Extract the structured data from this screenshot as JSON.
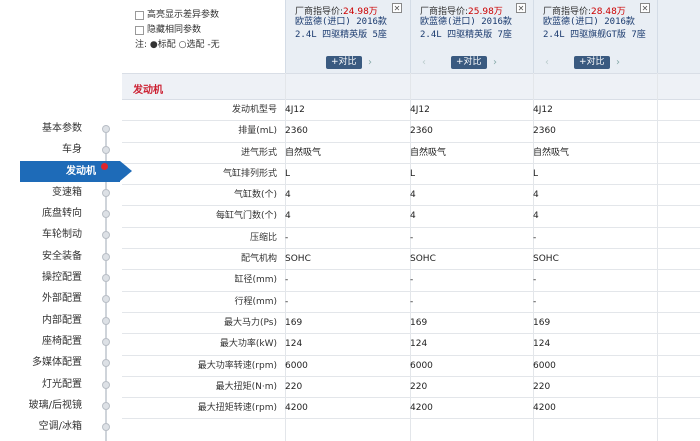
{
  "options": {
    "highlight_diff": "高亮显示差异参数",
    "hide_same": "隐藏相同参数",
    "legend": "注: ●标配 ○选配 -无"
  },
  "cars": [
    {
      "price_label": "厂商指导价:",
      "price": "24.98万",
      "name": "欧蓝德(进口) 2016款 2.4L 四驱精英版 5座",
      "compare": "+对比"
    },
    {
      "price_label": "厂商指导价:",
      "price": "25.98万",
      "name": "欧蓝德(进口) 2016款 2.4L 四驱精英版 7座",
      "compare": "+对比"
    },
    {
      "price_label": "厂商指导价:",
      "price": "28.48万",
      "name": "欧蓝德(进口) 2016款 2.4L 四驱旗舰GT版 7座",
      "compare": "+对比"
    }
  ],
  "section_title": "发动机",
  "rows": [
    {
      "label": "发动机型号",
      "values": [
        "4J12",
        "4J12",
        "4J12"
      ]
    },
    {
      "label": "排量(mL)",
      "values": [
        "2360",
        "2360",
        "2360"
      ]
    },
    {
      "label": "进气形式",
      "values": [
        "自然吸气",
        "自然吸气",
        "自然吸气"
      ]
    },
    {
      "label": "气缸排列形式",
      "values": [
        "L",
        "L",
        "L"
      ]
    },
    {
      "label": "气缸数(个)",
      "values": [
        "4",
        "4",
        "4"
      ]
    },
    {
      "label": "每缸气门数(个)",
      "values": [
        "4",
        "4",
        "4"
      ]
    },
    {
      "label": "压缩比",
      "values": [
        "-",
        "-",
        "-"
      ]
    },
    {
      "label": "配气机构",
      "values": [
        "SOHC",
        "SOHC",
        "SOHC"
      ]
    },
    {
      "label": "缸径(mm)",
      "values": [
        "-",
        "-",
        "-"
      ]
    },
    {
      "label": "行程(mm)",
      "values": [
        "-",
        "-",
        "-"
      ]
    },
    {
      "label": "最大马力(Ps)",
      "values": [
        "169",
        "169",
        "169"
      ]
    },
    {
      "label": "最大功率(kW)",
      "values": [
        "124",
        "124",
        "124"
      ]
    },
    {
      "label": "最大功率转速(rpm)",
      "values": [
        "6000",
        "6000",
        "6000"
      ]
    },
    {
      "label": "最大扭矩(N·m)",
      "values": [
        "220",
        "220",
        "220"
      ]
    },
    {
      "label": "最大扭矩转速(rpm)",
      "values": [
        "4200",
        "4200",
        "4200"
      ]
    }
  ],
  "nav": [
    {
      "label": "基本参数"
    },
    {
      "label": "车身"
    },
    {
      "label": "发动机",
      "active": true
    },
    {
      "label": "变速箱"
    },
    {
      "label": "底盘转向"
    },
    {
      "label": "车轮制动"
    },
    {
      "label": "安全装备"
    },
    {
      "label": "操控配置"
    },
    {
      "label": "外部配置"
    },
    {
      "label": "内部配置"
    },
    {
      "label": "座椅配置"
    },
    {
      "label": "多媒体配置"
    },
    {
      "label": "灯光配置"
    },
    {
      "label": "玻璃/后视镜"
    },
    {
      "label": "空调/冰箱"
    }
  ]
}
